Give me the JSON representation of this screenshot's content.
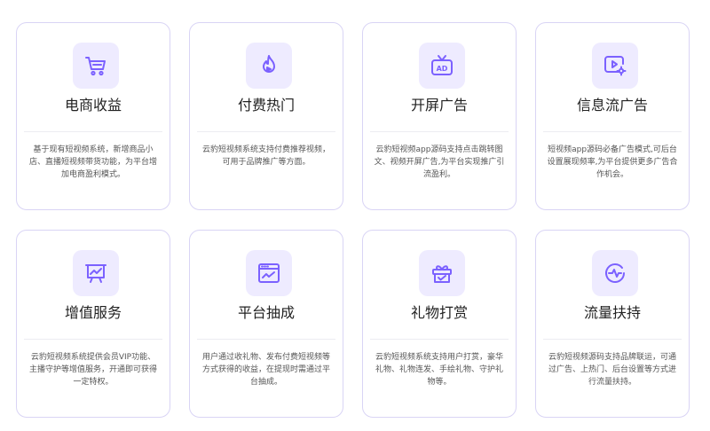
{
  "cards": [
    {
      "title": "电商收益",
      "icon": "shopping-cart-icon",
      "desc": "基于现有短视频系统，新增商品小店、直播短视频带货功能，为平台增加电商盈利模式。"
    },
    {
      "title": "付费热门",
      "icon": "fire-icon",
      "desc": "云豹短视频系统支持付费推荐视频，可用于品牌推广等方面。"
    },
    {
      "title": "开屏广告",
      "icon": "tv-ad-icon",
      "desc": "云豹短视频app源码支持点击跳转图文、视频开屏广告,为平台实现推广引流盈利。"
    },
    {
      "title": "信息流广告",
      "icon": "video-settings-icon",
      "desc": "短视频app源码必备广告模式,可后台设置展现频率,为平台提供更多广告合作机会。"
    },
    {
      "title": "增值服务",
      "icon": "presentation-chart-icon",
      "desc": "云豹短视频系统提供会员VIP功能、主播守护等增值服务，开通即可获得一定特权。"
    },
    {
      "title": "平台抽成",
      "icon": "browser-trend-icon",
      "desc": "用户通过收礼物、发布付费短视频等方式获得的收益，在提现时需通过平台抽成。"
    },
    {
      "title": "礼物打赏",
      "icon": "gift-icon",
      "desc": "云豹短视频系统支持用户打赏，豪华礼物、礼物连发、手绘礼物、守护礼物等。"
    },
    {
      "title": "流量扶持",
      "icon": "pulse-icon",
      "desc": "云豹短视频源码支持品牌联运，可通过广告、上热门、后台设置等方式进行流量扶持。"
    }
  ],
  "colors": {
    "accent": "#7b61ff",
    "icon_bg": "#eeebff",
    "border": "#d9d4f5"
  }
}
